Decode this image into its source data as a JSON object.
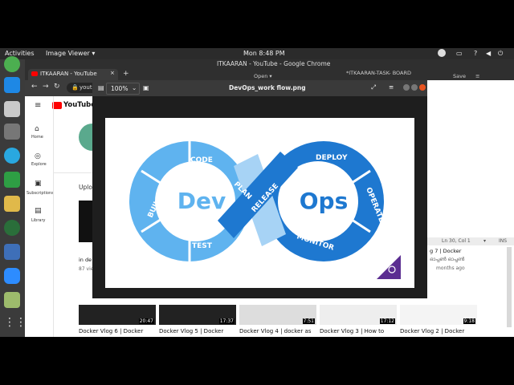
{
  "topbar": {
    "activities": "Activities",
    "app_menu": "Image Viewer ▾",
    "clock": "Mon  8:48 PM"
  },
  "chrome": {
    "title": "ITKAARAN - YouTube - Google Chrome",
    "tab_label": "ITKAARAN - YouTube",
    "new_tab": "+",
    "url": "yout"
  },
  "editor": {
    "open_label": "Open ▾",
    "title": "*ITKAARAN-TASK- BOARD",
    "save_label": "Save",
    "status_pos": "Ln 30, Col 1",
    "status_ins": "INS"
  },
  "viewer": {
    "zoom": "100%",
    "filename": "DevOps_work flow.png"
  },
  "devops": {
    "left_word": "Dev",
    "right_word": "Ops",
    "left_labels": [
      "CODE",
      "PLAN",
      "BUILD",
      "TEST",
      "RELEASE"
    ],
    "right_labels": [
      "DEPLOY",
      "OPERATE",
      "MONITOR"
    ]
  },
  "youtube": {
    "logo": "YouTube",
    "nav": [
      {
        "label": "Home"
      },
      {
        "label": "Explore"
      },
      {
        "label": "Subscriptions"
      },
      {
        "label": "Library"
      }
    ],
    "upload_label": "Uplo",
    "side_text": [
      "in de",
      "87 vie"
    ],
    "right_text": [
      "g 7 | Docker",
      "ഓപ്പൺ ഓപ്പൺ",
      "months ago"
    ],
    "videos": [
      {
        "duration": "20:47",
        "title": "Docker Vlog 6 | Docker"
      },
      {
        "duration": "17:37",
        "title": "Docker Vlog 5 | Docker"
      },
      {
        "duration": "7:51",
        "title": "Docker Vlog 4 | docker as"
      },
      {
        "duration": "17:12",
        "title": "Docker Vlog 3 | How to"
      },
      {
        "duration": "9:18",
        "title": "Docker Vlog 2 | Docker"
      }
    ]
  },
  "colors": {
    "dark_blue": "#1e78d0",
    "light_blue": "#5fb3ef",
    "pale_blue": "#a7d3f5",
    "purple": "#5b2d91",
    "yt_red": "#ff0000"
  }
}
